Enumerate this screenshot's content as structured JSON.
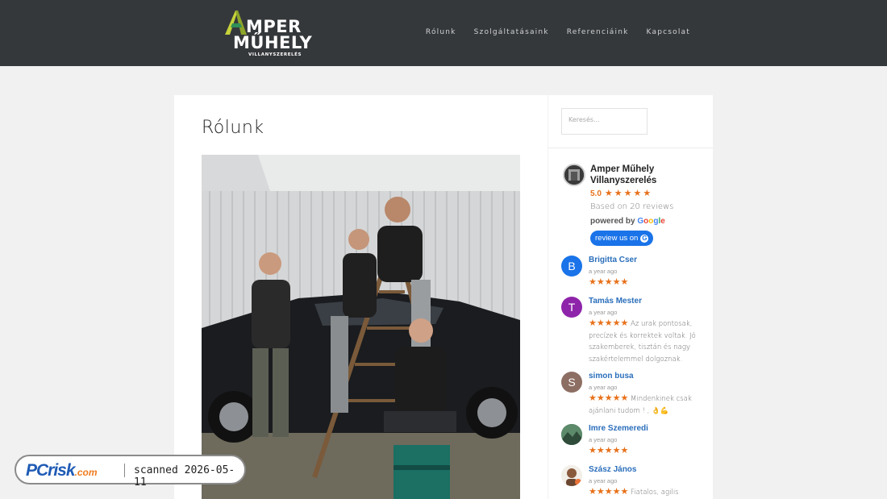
{
  "site": {
    "logo_line1": "MPER",
    "logo_line2": "MŰHELY",
    "logo_line3": "VILLANYSZERELÉS",
    "logo_image_alt": "Amper Műhely Villanyszerelés logo"
  },
  "nav": {
    "items": [
      {
        "label": "Rólunk"
      },
      {
        "label": "Szolgáltatásaink"
      },
      {
        "label": "Referenciáink"
      },
      {
        "label": "Kapcsolat"
      }
    ]
  },
  "main": {
    "title": "Rólunk",
    "photo_icon": "team-photo"
  },
  "sidebar": {
    "search_placeholder": "Keresés...",
    "business": {
      "name": "Amper Műhely Villanyszerelés",
      "rating": "5.0",
      "stars": 5,
      "based_on": "Based on 20 reviews",
      "powered_by": "powered by",
      "review_button": "review us on"
    },
    "reviews": [
      {
        "name": "Brigitta Cser",
        "initial": "B",
        "color": "#1a73e8",
        "time": "a year ago",
        "stars": 5,
        "text": ""
      },
      {
        "name": "Tamás Mester",
        "initial": "T",
        "color": "#8e24aa",
        "time": "a year ago",
        "stars": 5,
        "text": "Az urak pontosak, precízek és korrektek voltak. Jó szakemberek, tisztán és nagy szakértelemmel dolgoznak."
      },
      {
        "name": "simon busa",
        "initial": "S",
        "color": "#8d6e63",
        "time": "a year ago",
        "stars": 5,
        "text": "Mindenkinek csak ajánlani tudom ! , 👌💪"
      },
      {
        "name": "Imre Szemeredi",
        "initial": "",
        "color": "#3b6b4c",
        "time": "a year ago",
        "stars": 5,
        "text": ""
      },
      {
        "name": "Szász János",
        "initial": "",
        "color": "#b07050",
        "time": "a year ago",
        "stars": 5,
        "text": "Fiatalos, agilis"
      }
    ]
  },
  "watermark": {
    "brand": "PCrisk",
    "domain": ".com",
    "text": "scanned 2026-05-11"
  },
  "colors": {
    "header_bg": "#35383b",
    "star": "#e7711b",
    "reviewer_name": "#2a6ebb",
    "google_button": "#1a73e8"
  }
}
